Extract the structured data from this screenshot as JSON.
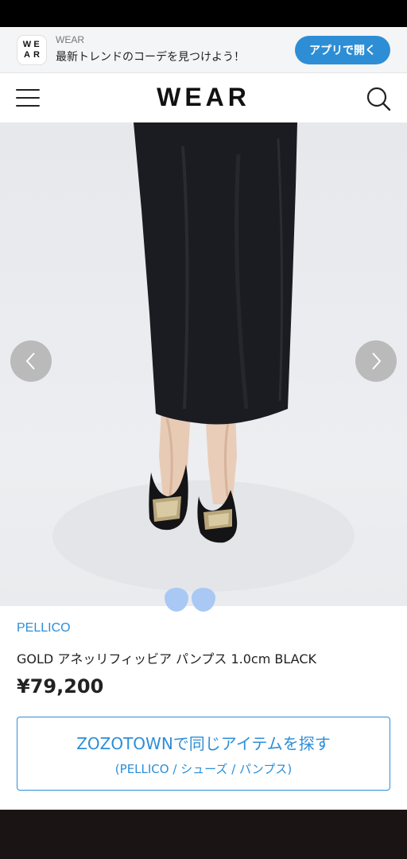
{
  "banner": {
    "app_icon_letters": [
      "W",
      "E",
      "A",
      "R"
    ],
    "app_name": "WEAR",
    "tagline": "最新トレンドのコーデを見つけよう！",
    "open_app_label": "アプリで開く"
  },
  "header": {
    "logo": "WEAR",
    "menu_icon": "hamburger-menu-icon",
    "search_icon": "search-icon"
  },
  "gallery": {
    "prev_icon": "chevron-left-icon",
    "next_icon": "chevron-right-icon",
    "slide_count": 2,
    "active_slide": 1
  },
  "product": {
    "brand": "PELLICO",
    "name": "GOLD アネッリフィッビア パンプス 1.0cm BLACK",
    "price": "¥79,200"
  },
  "zozo_button": {
    "main": "ZOZOTOWNで同じアイテムを探す",
    "sub": "(PELLICO / シューズ / パンプス)"
  },
  "colors": {
    "accent": "#2d8ed6",
    "dot": "#a9c8f4",
    "footer": "#1a1414"
  }
}
